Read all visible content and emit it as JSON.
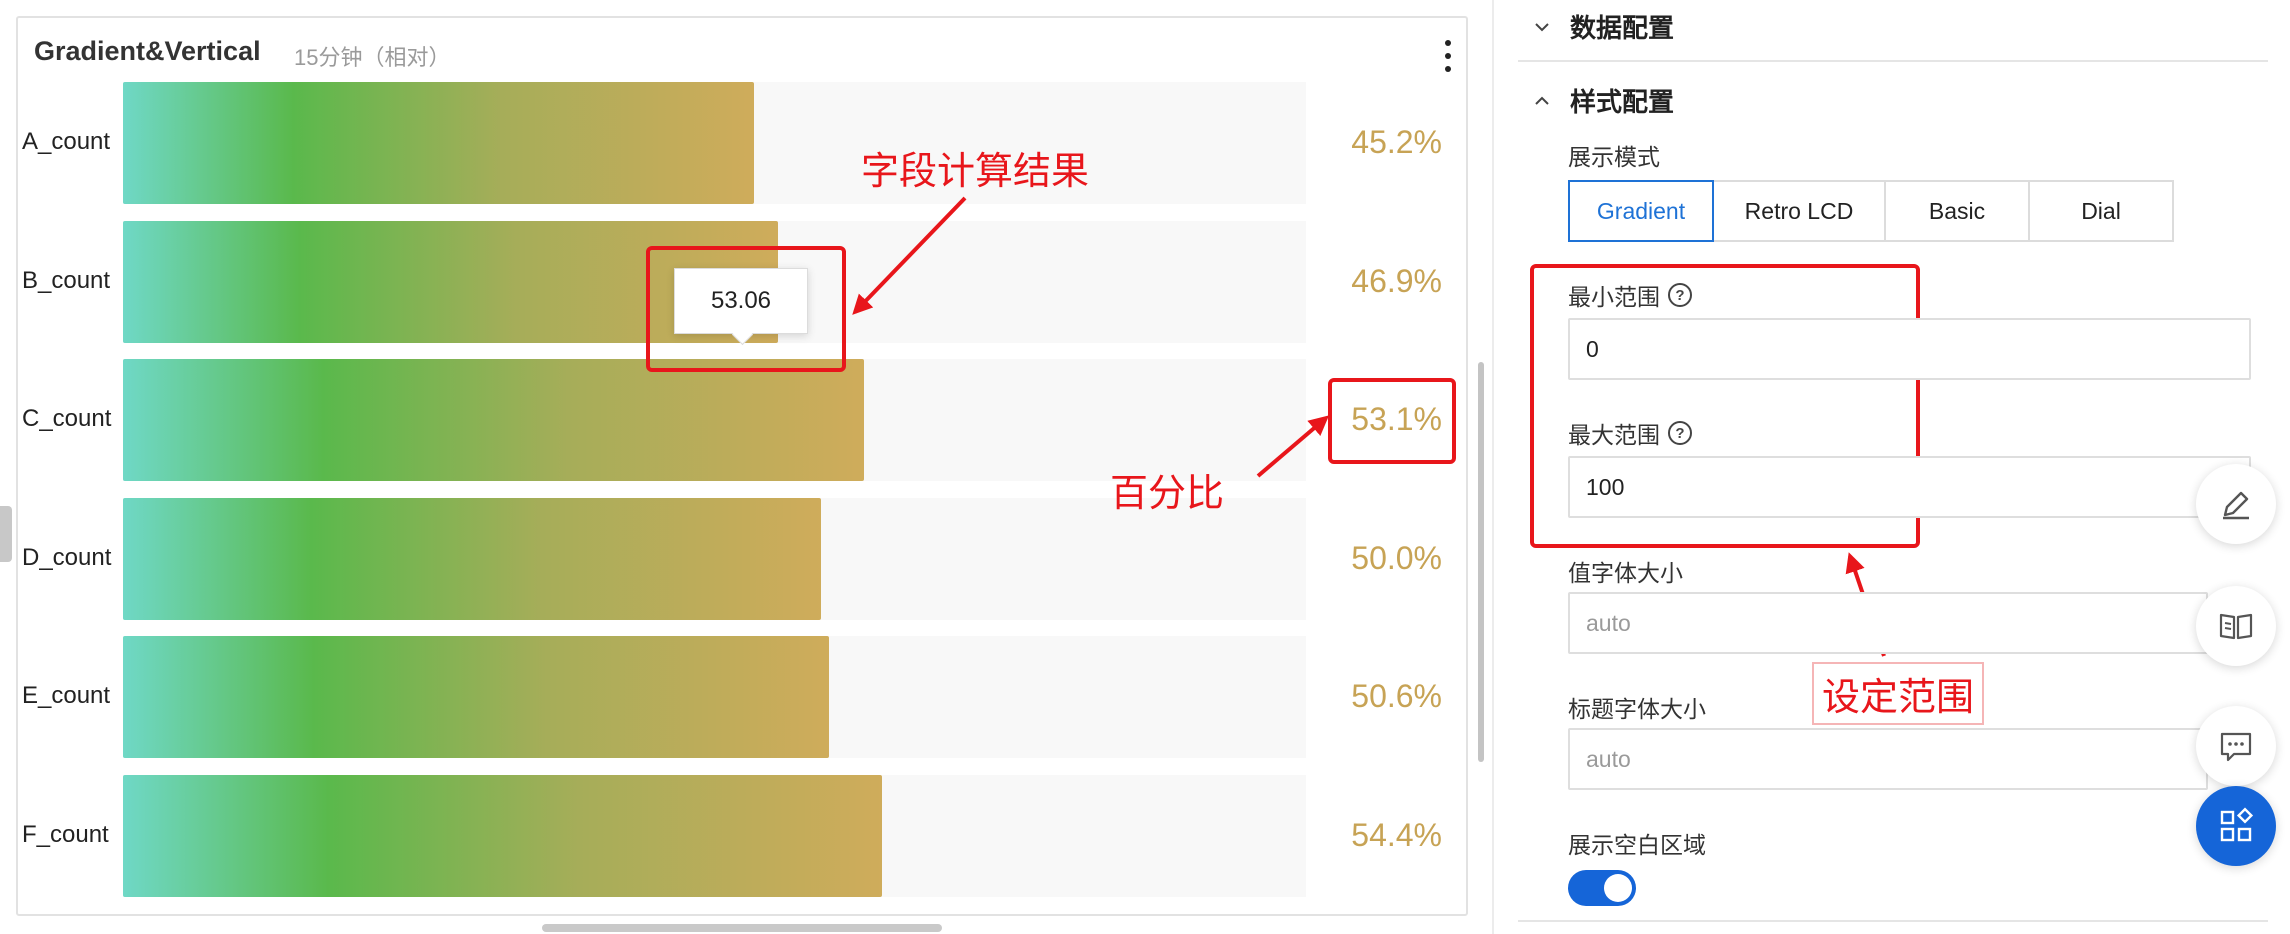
{
  "chart": {
    "title": "Gradient&Vertical",
    "subtitle": "15分钟（相对）",
    "tooltip_value": "53.06"
  },
  "chart_data": {
    "type": "bar",
    "orientation": "horizontal",
    "title": "Gradient&Vertical",
    "categories": [
      "A_count",
      "B_count",
      "C_count",
      "D_count",
      "E_count",
      "F_count"
    ],
    "values": [
      45.2,
      46.9,
      53.1,
      50.0,
      50.6,
      54.4
    ],
    "value_labels": [
      "45.2%",
      "46.9%",
      "53.1%",
      "50.0%",
      "50.6%",
      "54.4%"
    ],
    "xlim": [
      0,
      100
    ],
    "gradient_colors": [
      "#6fd8c6",
      "#5ab94c",
      "#cfac5b"
    ],
    "label_color": "#c7a355"
  },
  "annotations": {
    "field_result": "字段计算结果",
    "percent": "百分比",
    "set_range": "设定范围"
  },
  "config": {
    "data_section": "数据配置",
    "style_section": "样式配置",
    "display_mode_label": "展示模式",
    "modes": [
      "Gradient",
      "Retro LCD",
      "Basic",
      "Dial"
    ],
    "active_mode": "Gradient",
    "min_label": "最小范围",
    "min_value": "0",
    "max_label": "最大范围",
    "max_value": "100",
    "value_font_label": "值字体大小",
    "value_font_placeholder": "auto",
    "title_font_label": "标题字体大小",
    "title_font_placeholder": "auto",
    "show_blank_label": "展示空白区域",
    "show_blank_enabled": true
  },
  "colors": {
    "accent": "#1565d8",
    "annotation": "#e8161b"
  },
  "icons": [
    "more-vertical-icon",
    "help-icon",
    "edit-icon",
    "book-icon",
    "chat-icon",
    "apps-icon",
    "chevron-down-icon",
    "chevron-up-icon"
  ]
}
